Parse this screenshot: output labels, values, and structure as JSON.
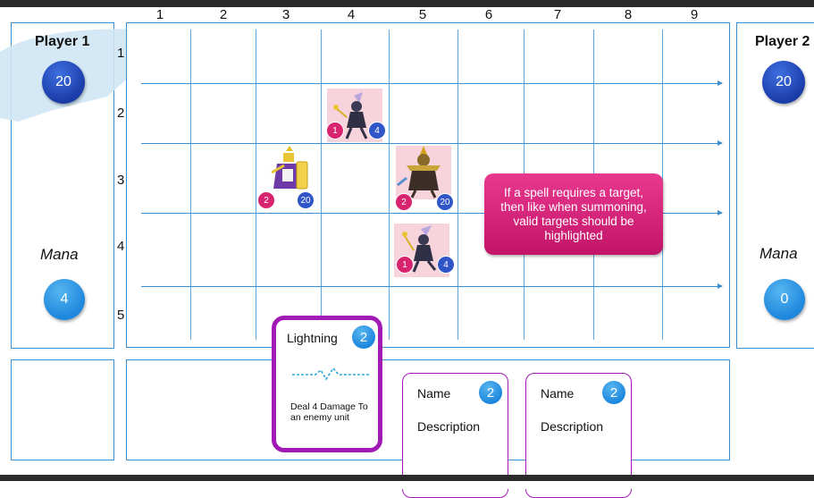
{
  "players": {
    "p1": {
      "name": "Player 1",
      "health": "20",
      "mana_label": "Mana",
      "mana": "4"
    },
    "p2": {
      "name": "Player 2",
      "health": "20",
      "mana_label": "Mana",
      "mana": "0"
    }
  },
  "board": {
    "col_labels": [
      "1",
      "2",
      "3",
      "4",
      "5",
      "6",
      "7",
      "8",
      "9"
    ],
    "row_labels": [
      "1",
      "2",
      "3",
      "4",
      "5"
    ],
    "units": [
      {
        "col": "4",
        "row": "2",
        "attack": "1",
        "health": "4"
      },
      {
        "col": "3",
        "row": "3",
        "attack": "2",
        "health": "20"
      },
      {
        "col": "5",
        "row": "3",
        "attack": "2",
        "health": "20"
      },
      {
        "col": "5",
        "row": "4",
        "attack": "1",
        "health": "4"
      }
    ]
  },
  "note": {
    "text": "If a spell requires a target, then like when summoning, valid targets should be highlighted"
  },
  "hand": {
    "selected": {
      "name": "Lightning",
      "cost": "2",
      "description": "Deal 4 Damage To an enemy unit",
      "border_color": "#a21ab5"
    },
    "cards": [
      {
        "name": "Name",
        "cost": "2",
        "description": "Description"
      },
      {
        "name": "Name",
        "cost": "2",
        "description": "Description"
      }
    ]
  },
  "colors": {
    "grid": "#5aa5e0",
    "panel_border": "#3b8fd0",
    "note": "#d8246f",
    "hp_badge": "#2f55c9",
    "atk_badge": "#d8246f",
    "mana": "#1e87dd"
  }
}
